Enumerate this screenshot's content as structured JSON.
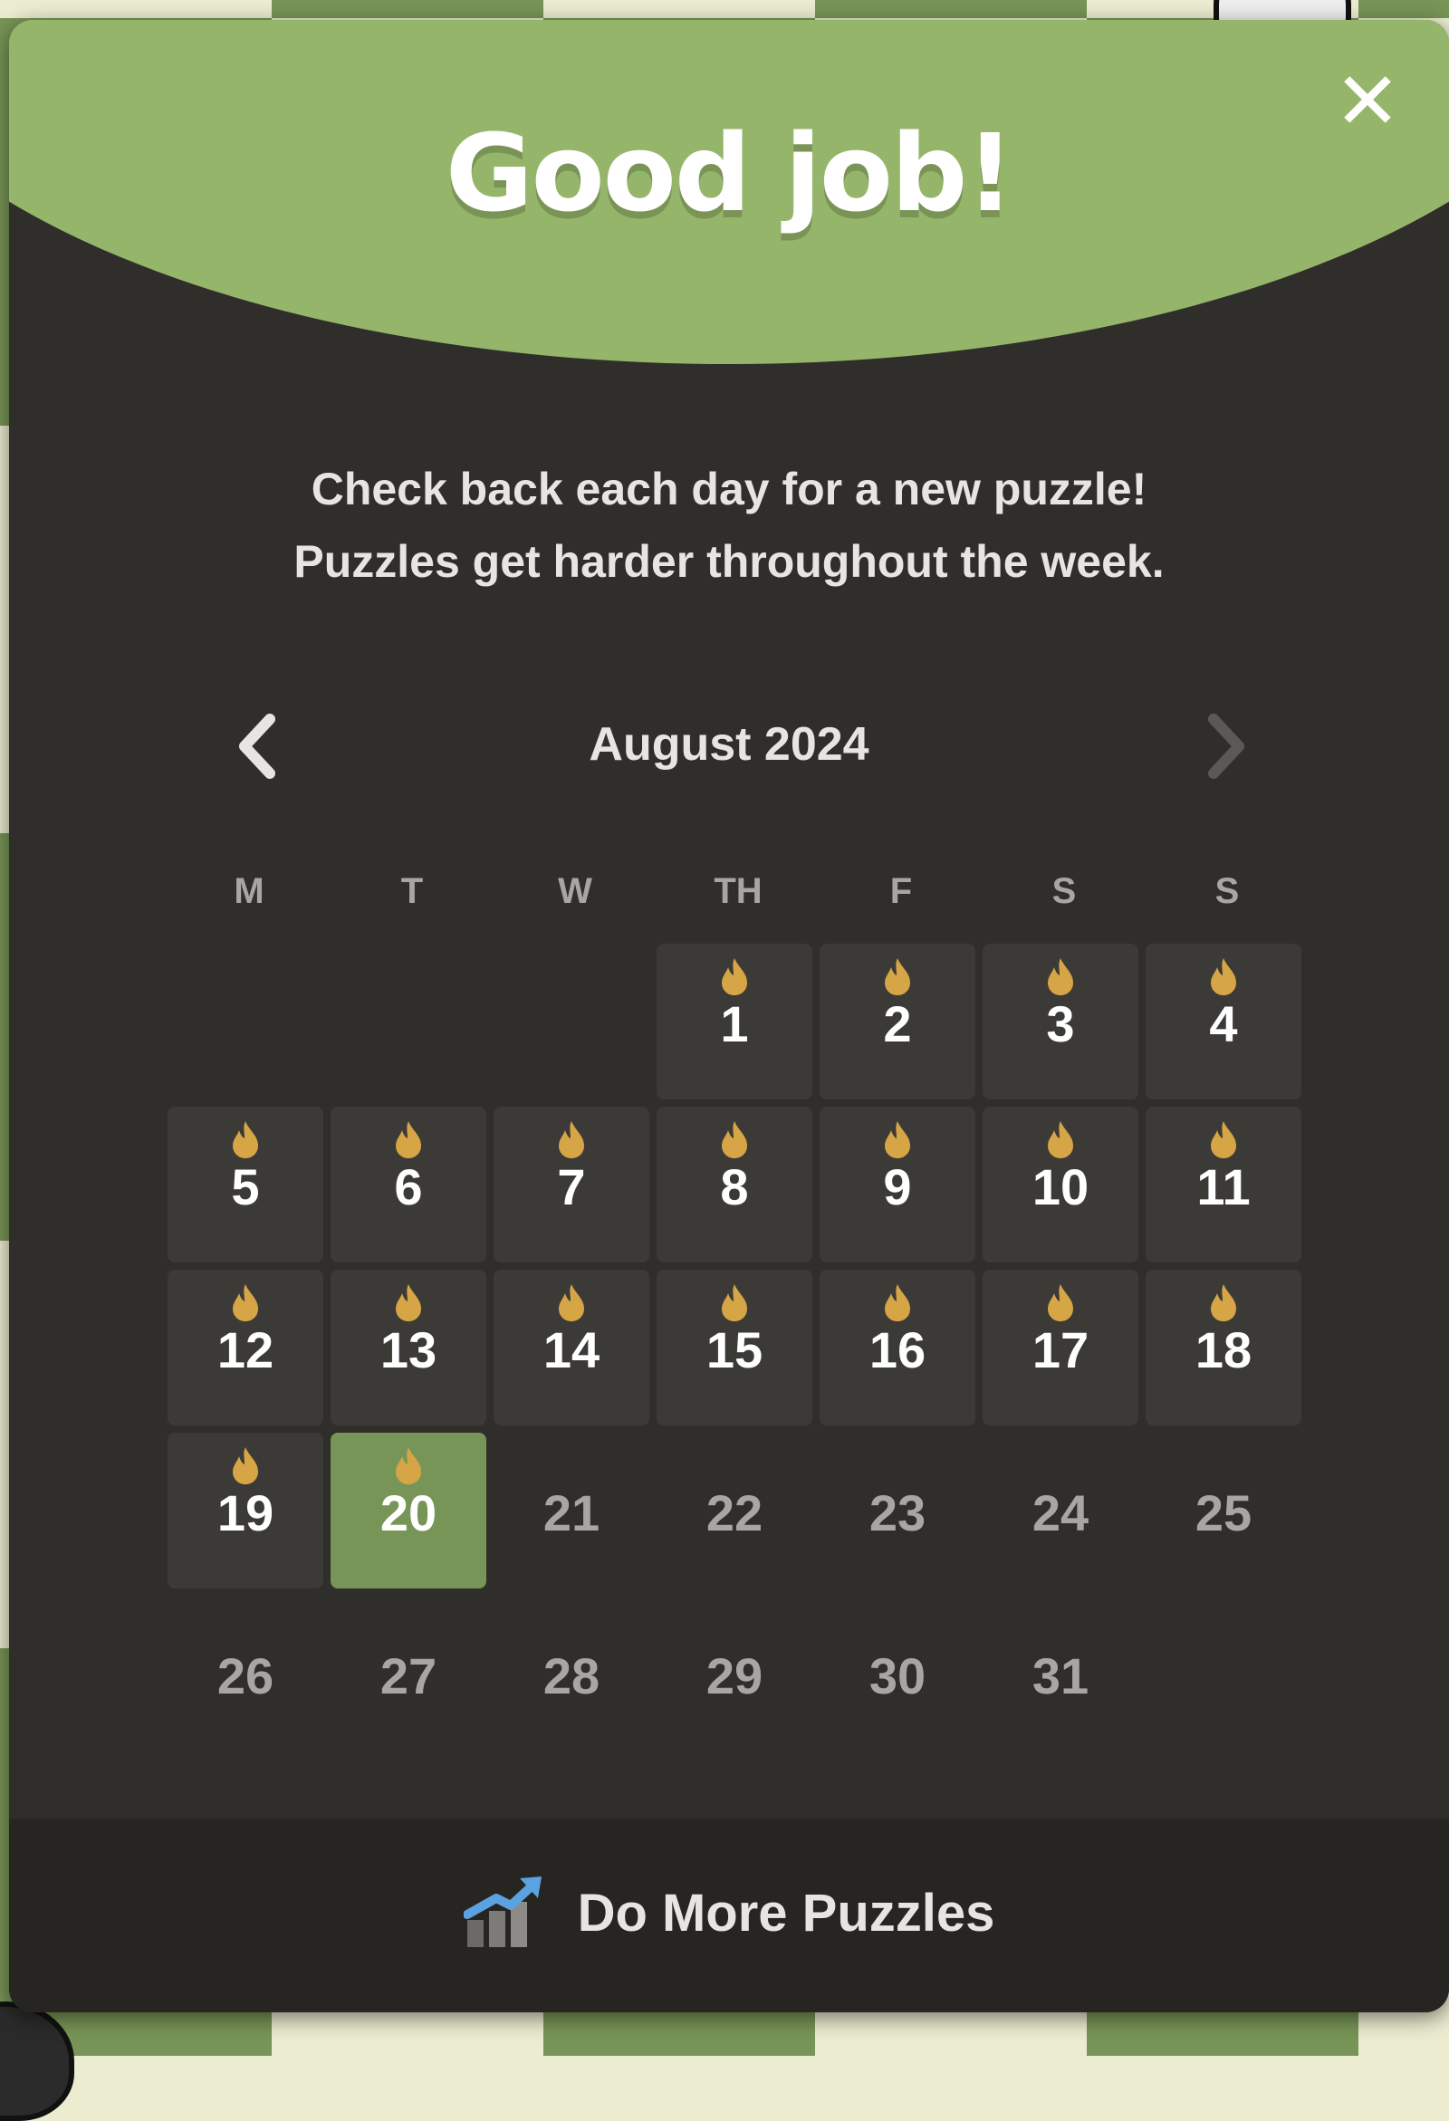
{
  "modal": {
    "title": "Good job!",
    "close_label": "✕",
    "subtitle_lines": [
      "Check back each day for a new puzzle!",
      "Puzzles get harder throughout the week."
    ]
  },
  "calendar": {
    "month_label": "August 2024",
    "prev_icon": "chevron-left-icon",
    "next_icon": "chevron-right-icon",
    "weekdays": [
      "M",
      "T",
      "W",
      "TH",
      "F",
      "S",
      "S"
    ],
    "leading_blanks": 3,
    "days_in_month": 31,
    "completed_days": [
      1,
      2,
      3,
      4,
      5,
      6,
      7,
      8,
      9,
      10,
      11,
      12,
      13,
      14,
      15,
      16,
      17,
      18,
      19,
      20
    ],
    "today": 20
  },
  "colors": {
    "header_green": "#95b56a",
    "panel": "#302e2b",
    "tile": "#3c3a37",
    "today": "#779556",
    "flame": "#d6a546",
    "muted_text": "#a7a6a2"
  },
  "footer": {
    "button_icon": "chart-up-icon",
    "button_label": "Do More Puzzles"
  }
}
